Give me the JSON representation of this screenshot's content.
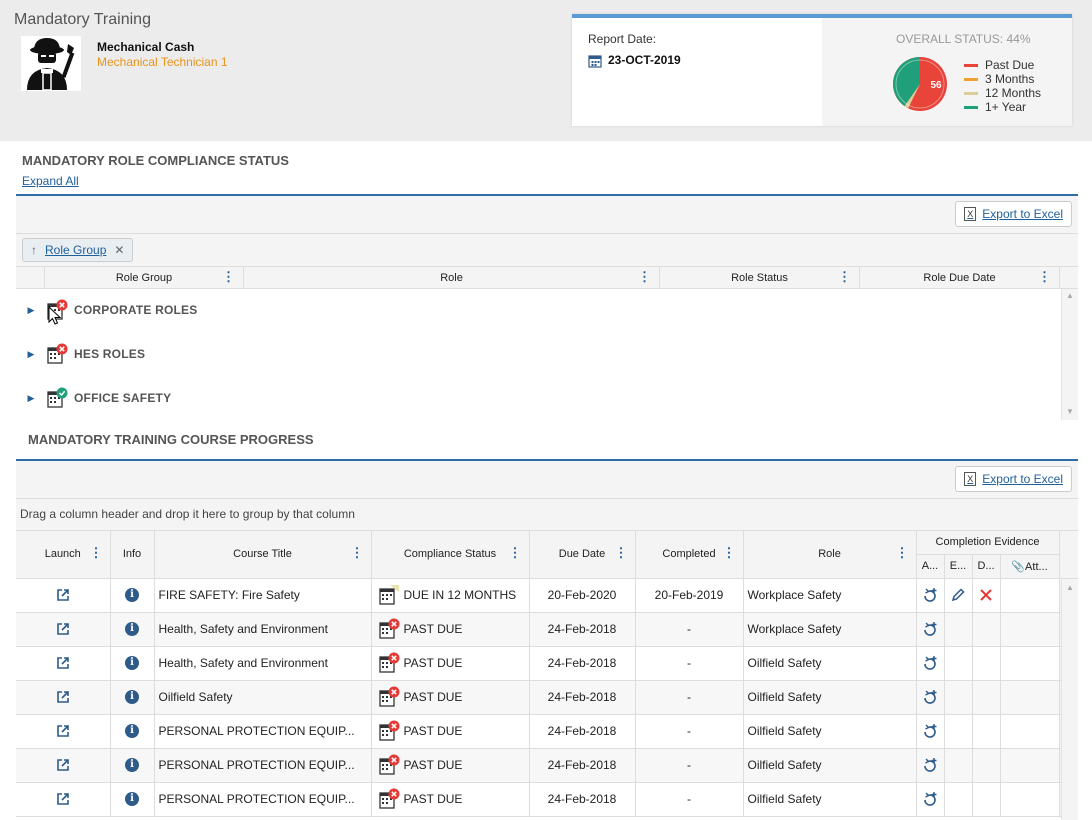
{
  "header": {
    "app_title": "Mandatory Training",
    "user_name": "Mechanical Cash",
    "user_role": "Mechanical Technician 1"
  },
  "status_card": {
    "report_label": "Report Date:",
    "report_date": "23-OCT-2019",
    "overall_status": "OVERALL STATUS: 44%",
    "donut_center_value": "56",
    "legend": [
      {
        "label": "Past Due",
        "color": "#e8443a"
      },
      {
        "label": "3 Months",
        "color": "#f0a030"
      },
      {
        "label": "12 Months",
        "color": "#d8cf9a"
      },
      {
        "label": "1+ Year",
        "color": "#20a07a"
      }
    ]
  },
  "role_section": {
    "title": "MANDATORY ROLE COMPLIANCE STATUS",
    "expand_all": "Expand All",
    "export_label": "Export to Excel",
    "group_chip": "Role Group",
    "columns": [
      "Role Group",
      "Role",
      "Role Status",
      "Role Due Date"
    ],
    "groups": [
      {
        "label": "CORPORATE ROLES",
        "status": "error"
      },
      {
        "label": "HES ROLES",
        "status": "error"
      },
      {
        "label": "OFFICE SAFETY",
        "status": "ok"
      }
    ]
  },
  "course_section": {
    "title": "MANDATORY TRAINING COURSE PROGRESS",
    "export_label": "Export to Excel",
    "drag_hint": "Drag a column header and drop it here to group by that column",
    "columns": {
      "launch": "Launch",
      "info": "Info",
      "course_title": "Course Title",
      "compliance_status": "Compliance Status",
      "due_date": "Due Date",
      "completed": "Completed",
      "role": "Role",
      "completion_evidence": "Completion Evidence",
      "ev_a": "A...",
      "ev_e": "E...",
      "ev_d": "D...",
      "ev_att": "Att..."
    },
    "rows": [
      {
        "title": "FIRE SAFETY: Fire Safety",
        "status": "DUE IN 12 MONTHS",
        "due": "20-Feb-2020",
        "completed": "20-Feb-2019",
        "role": "Workplace Safety"
      },
      {
        "title": "Health, Safety and Environment",
        "status": "PAST DUE",
        "due": "24-Feb-2018",
        "completed": "-",
        "role": "Workplace Safety"
      },
      {
        "title": "Health, Safety and Environment",
        "status": "PAST DUE",
        "due": "24-Feb-2018",
        "completed": "-",
        "role": "Oilfield Safety"
      },
      {
        "title": "Oilfield Safety",
        "status": "PAST DUE",
        "due": "24-Feb-2018",
        "completed": "-",
        "role": "Oilfield Safety"
      },
      {
        "title": "PERSONAL PROTECTION EQUIP...",
        "status": "PAST DUE",
        "due": "24-Feb-2018",
        "completed": "-",
        "role": "Oilfield Safety"
      },
      {
        "title": "PERSONAL PROTECTION EQUIP...",
        "status": "PAST DUE",
        "due": "24-Feb-2018",
        "completed": "-",
        "role": "Oilfield Safety"
      },
      {
        "title": "PERSONAL PROTECTION EQUIP...",
        "status": "PAST DUE",
        "due": "24-Feb-2018",
        "completed": "-",
        "role": "Oilfield Safety"
      }
    ]
  }
}
